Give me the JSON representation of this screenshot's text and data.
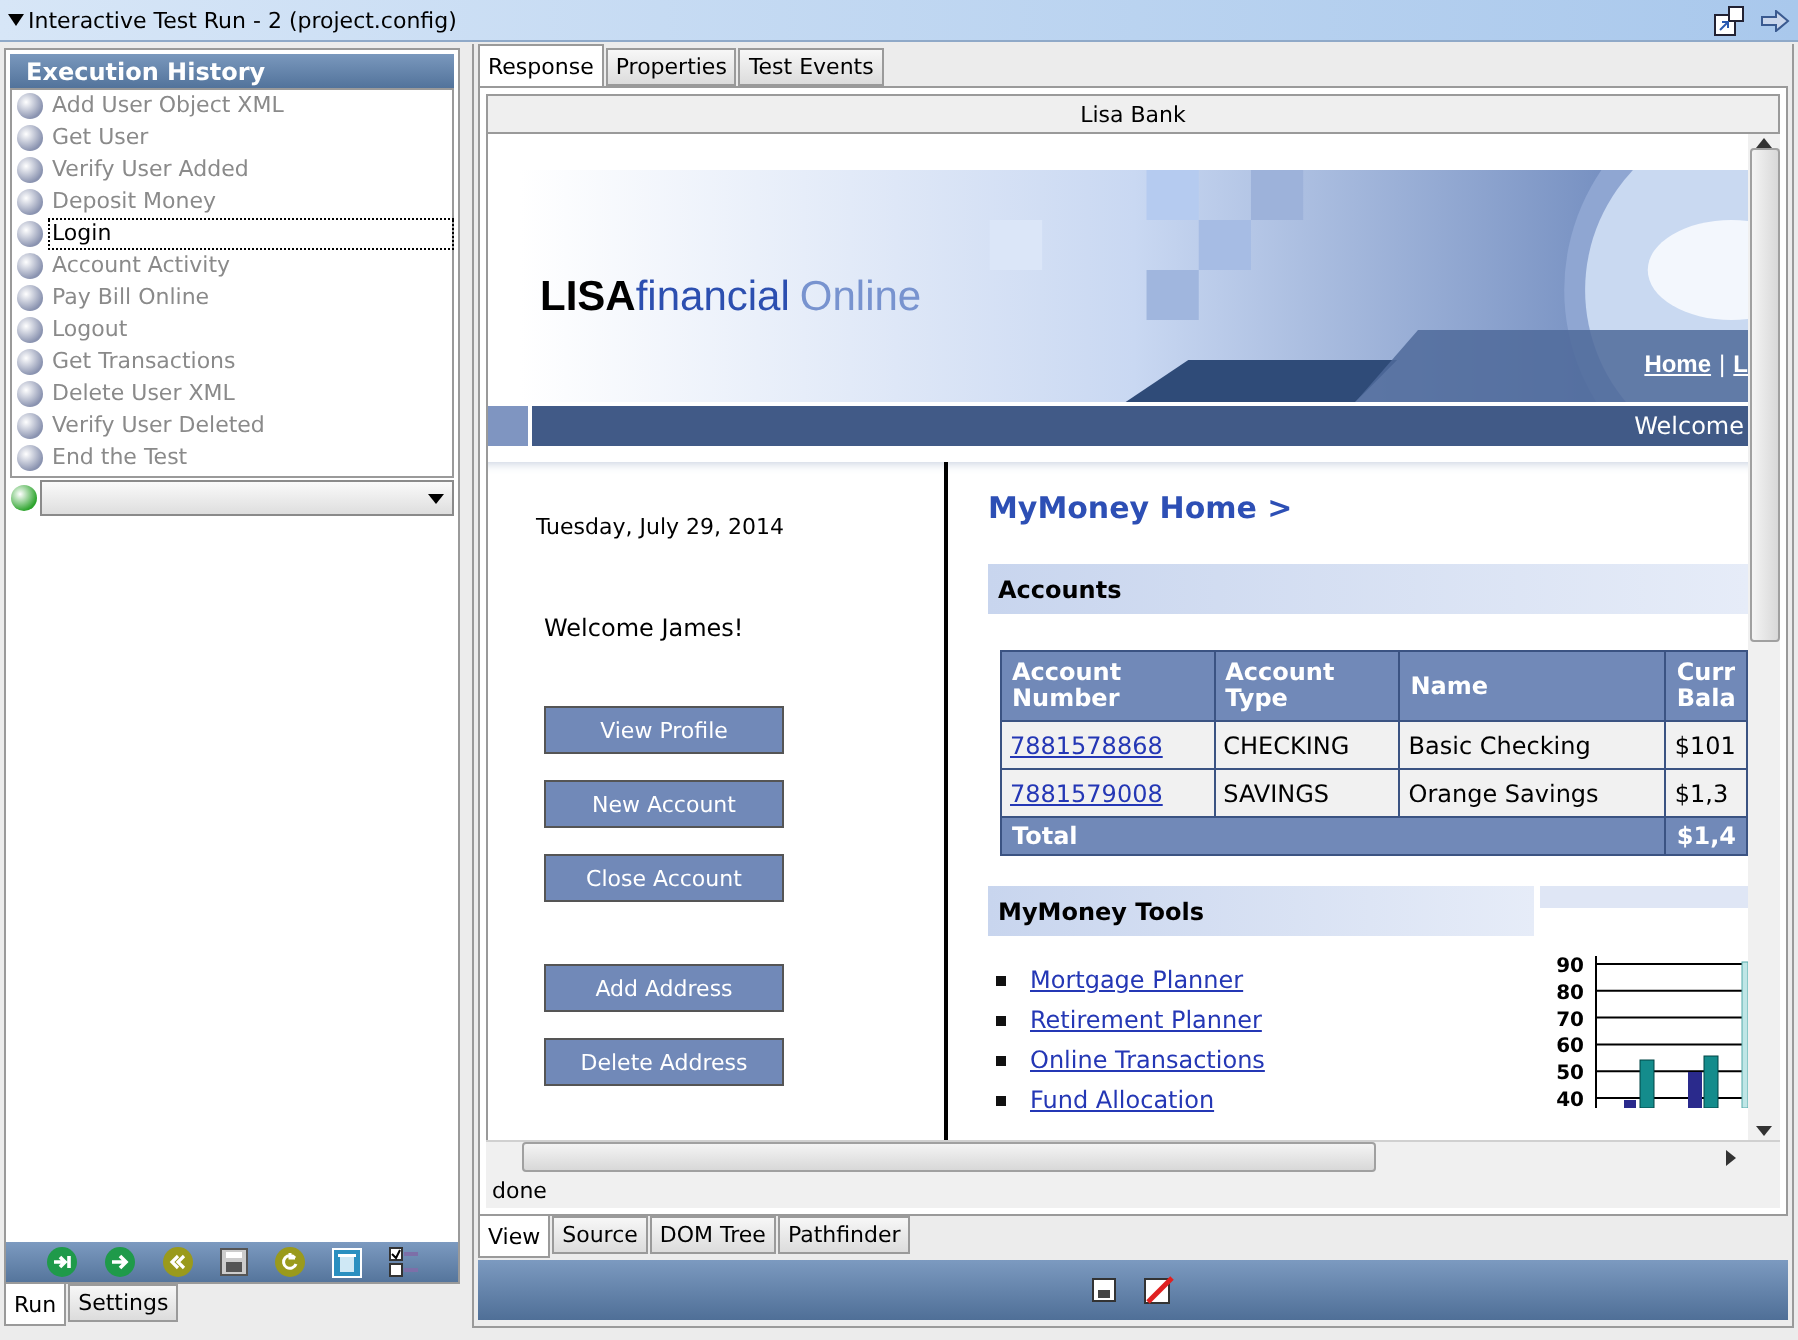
{
  "window": {
    "title": "Interactive Test Run - 2 (project.config)"
  },
  "execution_history": {
    "title": "Execution History",
    "items": [
      {
        "label": "Add User Object XML",
        "focused": false
      },
      {
        "label": "Get User",
        "focused": false
      },
      {
        "label": "Verify User Added",
        "focused": false
      },
      {
        "label": "Deposit Money",
        "focused": false
      },
      {
        "label": "Login",
        "focused": true
      },
      {
        "label": "Account Activity",
        "focused": false
      },
      {
        "label": "Pay Bill Online",
        "focused": false
      },
      {
        "label": "Logout",
        "focused": false
      },
      {
        "label": "Get Transactions",
        "focused": false
      },
      {
        "label": "Delete User XML",
        "focused": false
      },
      {
        "label": "Verify User Deleted",
        "focused": false
      },
      {
        "label": "End the Test",
        "focused": false
      }
    ]
  },
  "left_tabs": [
    {
      "label": "Run",
      "selected": true
    },
    {
      "label": "Settings",
      "selected": false
    }
  ],
  "right_tabs": [
    {
      "label": "Response",
      "selected": true
    },
    {
      "label": "Properties",
      "selected": false
    },
    {
      "label": "Test Events",
      "selected": false
    }
  ],
  "browser": {
    "title": "Lisa Bank",
    "status": "done",
    "page": {
      "logo": {
        "brand": "LISA",
        "word": "financial",
        "tail": "Online"
      },
      "nav_links": [
        "Home",
        "L"
      ],
      "nav_separator": "|",
      "welcome_bar": "Welcome",
      "date": "Tuesday, July 29, 2014",
      "greeting": "Welcome James!",
      "button_groups": [
        [
          "View Profile",
          "New Account",
          "Close Account"
        ],
        [
          "Add Address",
          "Delete Address"
        ]
      ],
      "heading": "MyMoney Home >",
      "accounts_title": "Accounts",
      "table": {
        "columns": [
          "Account Number",
          "Account Type",
          "Name",
          "Curr Bala"
        ],
        "rows": [
          [
            "7881578868",
            "CHECKING",
            "Basic Checking",
            "$101"
          ],
          [
            "7881579008",
            "SAVINGS",
            "Orange Savings",
            "$1,3"
          ]
        ],
        "total": {
          "label": "Total",
          "value": "$1,4"
        }
      },
      "tools_title": "MyMoney Tools",
      "tools_links": [
        "Mortgage Planner",
        "Retirement Planner",
        "Online Transactions",
        "Fund Allocation"
      ],
      "chart_ticks": [
        "90",
        "80",
        "70",
        "60",
        "50",
        "40"
      ]
    }
  },
  "bottom_tabs": [
    {
      "label": "View",
      "selected": true
    },
    {
      "label": "Source",
      "selected": false
    },
    {
      "label": "DOM Tree",
      "selected": false
    },
    {
      "label": "Pathfinder",
      "selected": false
    }
  ]
}
